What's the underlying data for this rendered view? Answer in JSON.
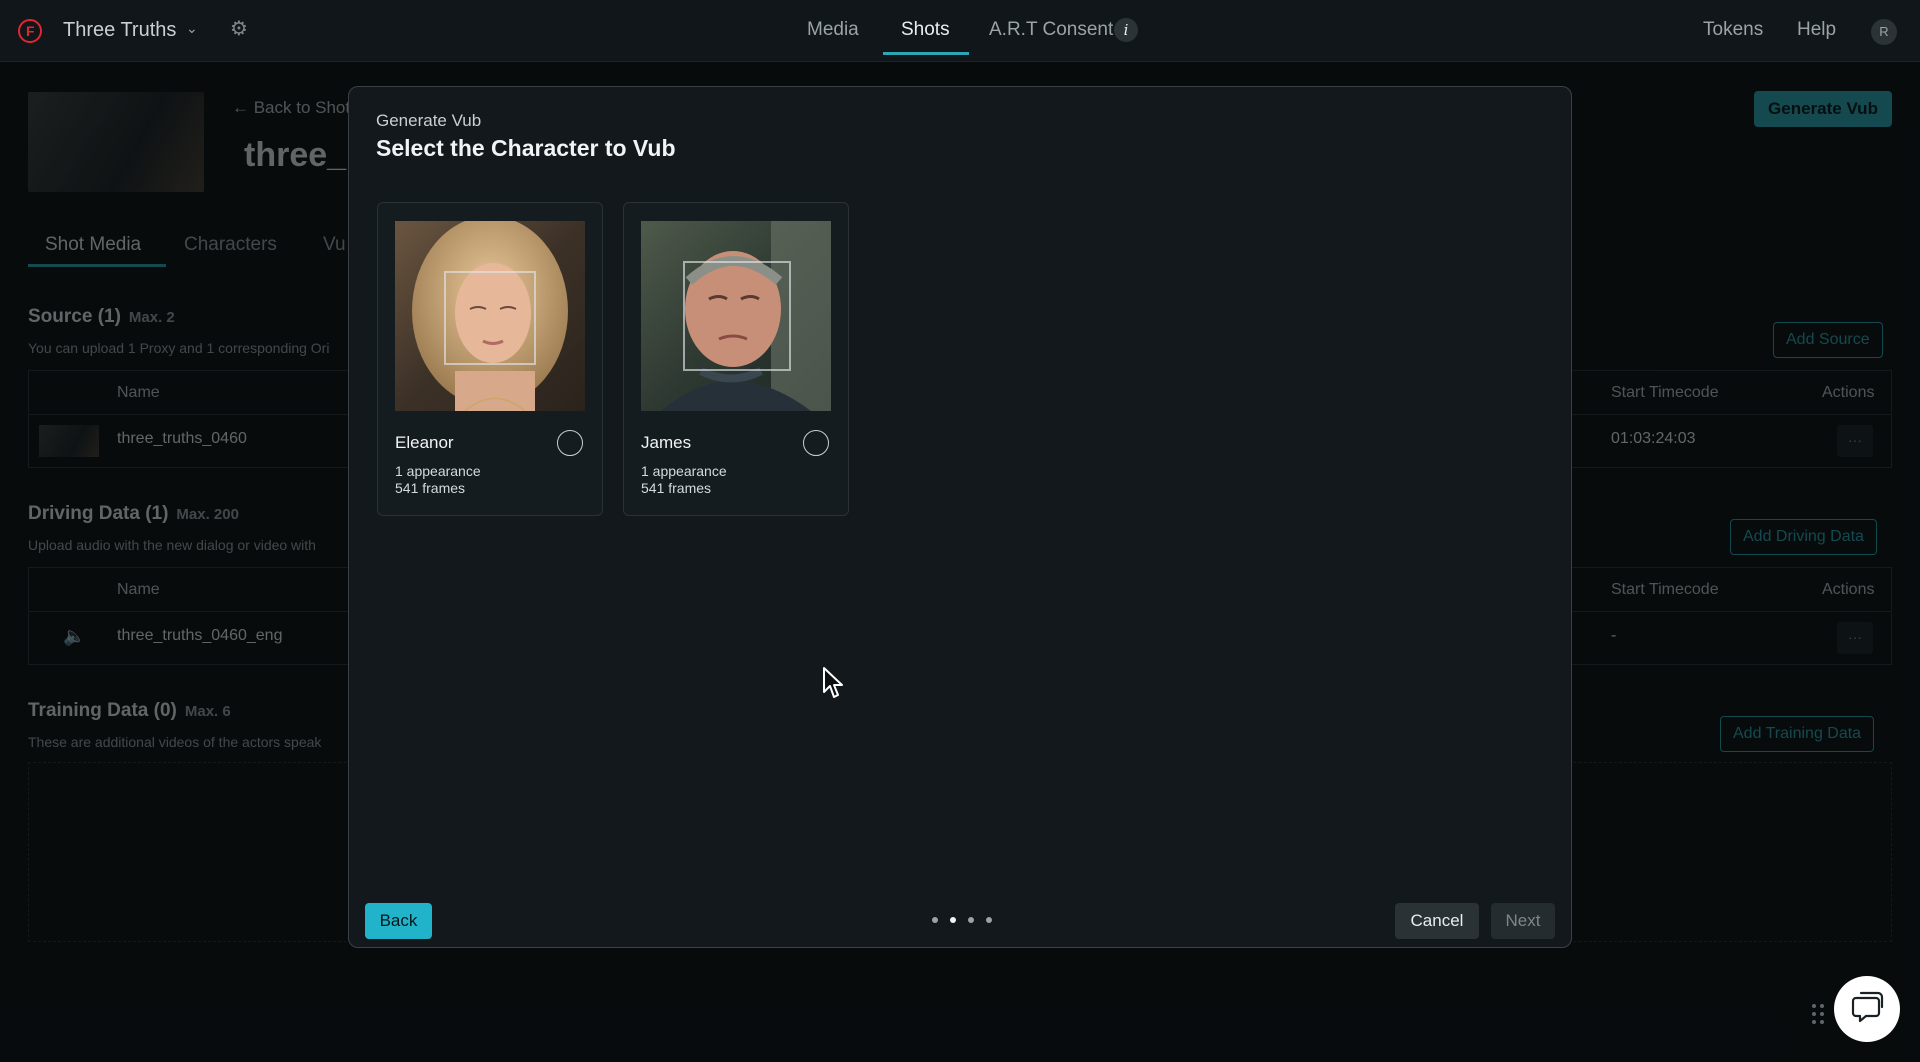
{
  "nav": {
    "project_name": "Three Truths",
    "tabs": [
      {
        "label": "Media"
      },
      {
        "label": "Shots"
      },
      {
        "label": "A.R.T Consent"
      }
    ],
    "active_tab": "Shots",
    "tokens": "Tokens",
    "help": "Help",
    "avatar_initial": "R"
  },
  "page": {
    "back_link": "← Back to Shot",
    "title": "three_",
    "generate_vub": "Generate Vub",
    "sub_tabs": [
      "Shot Media",
      "Characters",
      "Vu"
    ],
    "source": {
      "title": "Source (1)",
      "max": "Max. 2",
      "desc": "You can upload 1 Proxy and 1 corresponding Ori",
      "add_button": "Add Source",
      "columns": {
        "name": "Name",
        "start": "Start Timecode",
        "actions": "Actions"
      },
      "rows": [
        {
          "name": "three_truths_0460",
          "start": "01:03:24:03",
          "actions": "···"
        }
      ]
    },
    "driving": {
      "title": "Driving Data (1)",
      "max": "Max. 200",
      "desc": "Upload audio with the new dialog or video with",
      "add_button": "Add Driving Data",
      "columns": {
        "name": "Name",
        "start": "Start Timecode",
        "actions": "Actions"
      },
      "rows": [
        {
          "name": "three_truths_0460_eng",
          "start": "-",
          "actions": "···"
        }
      ]
    },
    "training": {
      "title": "Training Data (0)",
      "max": "Max. 6",
      "desc": "These are additional videos of the actors speak",
      "add_button": "Add Training Data"
    }
  },
  "modal": {
    "eyebrow": "Generate Vub",
    "title": "Select the Character to Vub",
    "characters": [
      {
        "name": "Eleanor",
        "appearances": "1 appearance",
        "frames": "541 frames"
      },
      {
        "name": "James",
        "appearances": "1 appearance",
        "frames": "541 frames"
      }
    ],
    "back": "Back",
    "cancel": "Cancel",
    "next": "Next",
    "steps_total": 4,
    "step_current": 2
  },
  "colors": {
    "accent": "#2aa6b5",
    "background": "#0a0f11",
    "modal_bg": "#12181b",
    "brand_red": "#e0262f"
  },
  "icons": [
    "logo-icon",
    "chevron-down-icon",
    "gear-icon",
    "info-icon",
    "speaker-icon",
    "cursor-icon",
    "drag-handle-icon",
    "chat-icon"
  ]
}
